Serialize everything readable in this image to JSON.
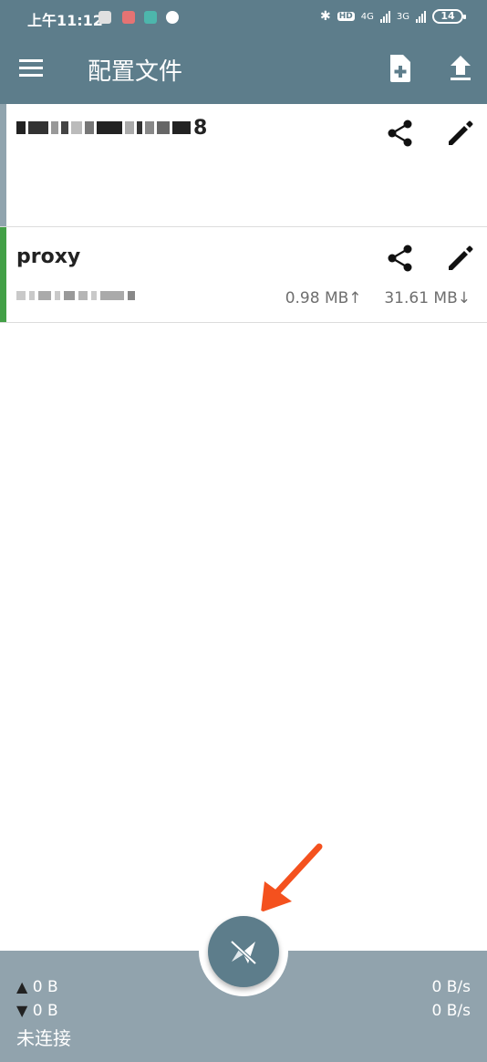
{
  "status_bar": {
    "time": "上午11:12",
    "net1": "4G",
    "net2": "3G",
    "hd": "HD",
    "battery": "14"
  },
  "app_bar": {
    "title": "配置文件"
  },
  "profiles": [
    {
      "name": "8",
      "name_redacted": true,
      "stripe_color": "#90a4ae"
    },
    {
      "name": "proxy",
      "upload": "0.98 MB↑",
      "download": "31.61 MB↓",
      "stripe_color": "#43a047"
    }
  ],
  "bottom_bar": {
    "up_total": "0 B",
    "down_total": "0 B",
    "up_rate": "0 B/s",
    "down_rate": "0 B/s",
    "connection_status": "未连接"
  },
  "colors": {
    "primary": "#5d7d8b",
    "bottom_panel": "#91a3ad",
    "annotation_arrow": "#f4511e"
  }
}
